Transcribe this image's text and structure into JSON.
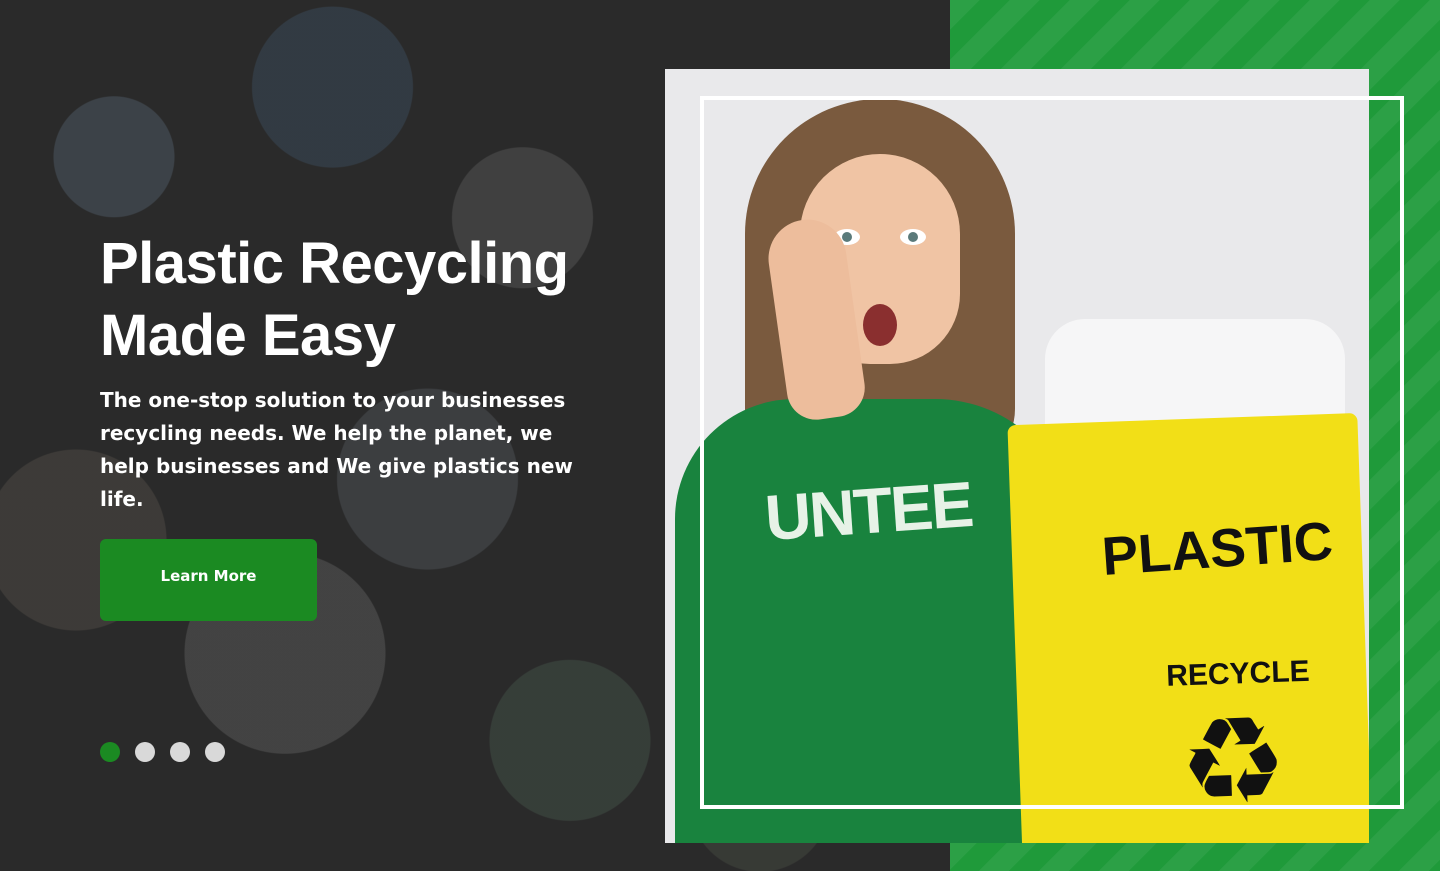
{
  "hero": {
    "title": "Plastic Recycling Made Easy",
    "subtitle": "The one-stop solution to your businesses recycling needs. We help the planet, we help businesses and We give plastics new life.",
    "cta_label": "Learn More"
  },
  "carousel": {
    "total": 4,
    "active": 1
  },
  "photo": {
    "shirt_text": "UNTEE",
    "bag_label": "PLASTIC",
    "bag_recycle_text": "RECYCLE",
    "bag_symbol": "♻"
  },
  "colors": {
    "accent": "#1b8a22",
    "right_bg": "#1f9a3a",
    "bag": "#f2df17"
  }
}
